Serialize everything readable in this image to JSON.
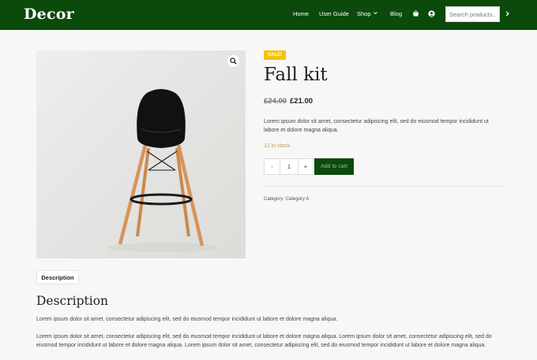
{
  "header": {
    "logo": "Decor",
    "nav": {
      "home": "Home",
      "user_guide": "User Guide",
      "shop": "Shop",
      "blog": "Blog"
    },
    "search": {
      "placeholder": "Search products..."
    },
    "icons": [
      "cart-icon",
      "user-icon",
      "chevron-right-icon",
      "chevron-down-icon"
    ],
    "bg_color": "#0b4a0b"
  },
  "product": {
    "sale_badge": "SALE!",
    "title": "Fall kit",
    "price_old": "£24.00",
    "price_new": "£21.00",
    "short_description": "Lorem ipsum dolor sit amet, consectetur adipiscing elit, sed do eiusmod tempor incididunt ut labore et dolore magna aliqua.",
    "stock": "12 in stock",
    "quantity": {
      "minus": "-",
      "value": "1",
      "plus": "+"
    },
    "add_to_cart": "Add to cart",
    "category_label": "Category:",
    "category_value": "Category A",
    "image_icon": "zoom-icon"
  },
  "tabs": {
    "description": "Description"
  },
  "description": {
    "heading": "Description",
    "para1": "Lorem ipsum dolor sit amet, consectetur adipiscing elit, sed do eiusmod tempor incididunt ut labore et dolore magna aliqua.",
    "para2": "Lorem ipsum dolor sit amet, consectetur adipiscing elit, sed do eiusmod tempor incididunt ut labore et dolore magna aliqua. Lorem ipsum dolor sit amet, consectetur adipiscing elit, sed do eiusmod tempor incididunt ut labore et dolore magna aliqua. Lorem ipsum dolor sit amet, consectetur adipiscing elit, sed do eiusmod tempor incididunt ut labore et dolore magna aliqua."
  },
  "colors": {
    "brand": "#0b4a0b",
    "sale": "#f5c300",
    "stock": "#c5a34a",
    "background": "#f7f7f7"
  }
}
